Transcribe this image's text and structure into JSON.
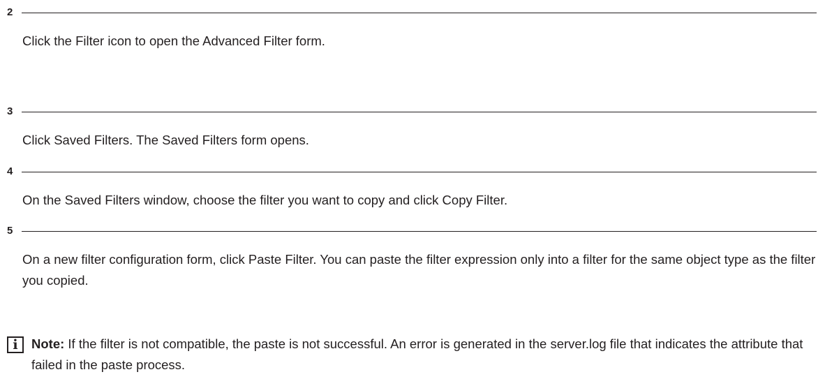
{
  "steps": [
    {
      "number": "2",
      "text": "Click the Filter icon to open the Advanced Filter form."
    },
    {
      "number": "3",
      "text": "Click Saved Filters. The Saved Filters form opens."
    },
    {
      "number": "4",
      "text": "On the Saved Filters window, choose the filter you want to copy and click Copy Filter."
    },
    {
      "number": "5",
      "text": "On a new filter configuration form, click Paste Filter. You can paste the filter expression only into a filter for the same object type as the filter you copied."
    }
  ],
  "note": {
    "icon": "info-icon",
    "icon_glyph": "i",
    "label": "Note:",
    "text": "If the filter is not compatible, the paste is not successful. An error is generated in the server.log file that indicates the attribute that failed in the paste process."
  }
}
